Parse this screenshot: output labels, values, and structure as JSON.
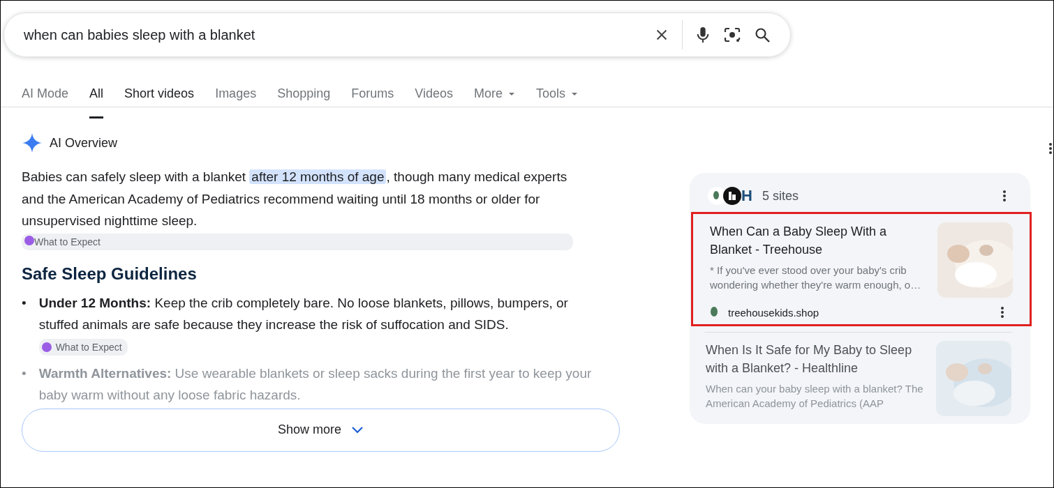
{
  "search": {
    "value": "when can babies sleep with a blanket"
  },
  "tabs": [
    {
      "label": "AI Mode",
      "selected": false,
      "dropdown": false
    },
    {
      "label": "All",
      "selected": true,
      "dropdown": false
    },
    {
      "label": "Short videos",
      "selected": false,
      "dropdown": false
    },
    {
      "label": "Images",
      "selected": false,
      "dropdown": false
    },
    {
      "label": "Shopping",
      "selected": false,
      "dropdown": false
    },
    {
      "label": "Forums",
      "selected": false,
      "dropdown": false
    },
    {
      "label": "Videos",
      "selected": false,
      "dropdown": false
    },
    {
      "label": "More",
      "selected": false,
      "dropdown": true
    },
    {
      "label": "Tools",
      "selected": false,
      "dropdown": true
    }
  ],
  "overview": {
    "title": "AI Overview",
    "summary": {
      "before": "Babies can safely sleep with a blanket ",
      "highlight": "after 12 months of age",
      "after": ", though many medical experts and the American Academy of Pediatrics recommend waiting until 18 months or older for unsupervised nighttime sleep.",
      "source": "What to Expect"
    },
    "heading": "Safe Sleep Guidelines",
    "bullets": [
      {
        "marker": "•",
        "term": "Under 12 Months:",
        "text": "Keep the crib completely bare. No loose blankets, pillows, bumpers, or stuffed animals are safe because they increase the risk of suffocation and SIDS.",
        "source": "What to Expect",
        "faded": false
      },
      {
        "marker": "•",
        "term": "Warmth Alternatives:",
        "text": "Use wearable blankets or sleep sacks during the first year to keep your baby warm without any loose fabric hazards.",
        "faded": true
      }
    ],
    "show_more": "Show more"
  },
  "sources": {
    "logos": [
      {
        "kind": "leaf"
      },
      {
        "kind": "house"
      },
      {
        "kind": "letter",
        "text": "H"
      }
    ],
    "count": "5 sites",
    "items": [
      {
        "title": "When Can a Baby Sleep With a Blanket - Treehouse",
        "snippet": "* If you've ever stood over your baby's crib wondering whether they're warm enough, o…",
        "site": "treehousekids.shop",
        "highlighted": true,
        "faded": false
      },
      {
        "title": "When Is It Safe for My Baby to Sleep with a Blanket? - Healthline",
        "snippet": "When can your baby sleep with a blanket? The American Academy of Pediatrics (AAP",
        "highlighted": false,
        "faded": true
      }
    ]
  }
}
